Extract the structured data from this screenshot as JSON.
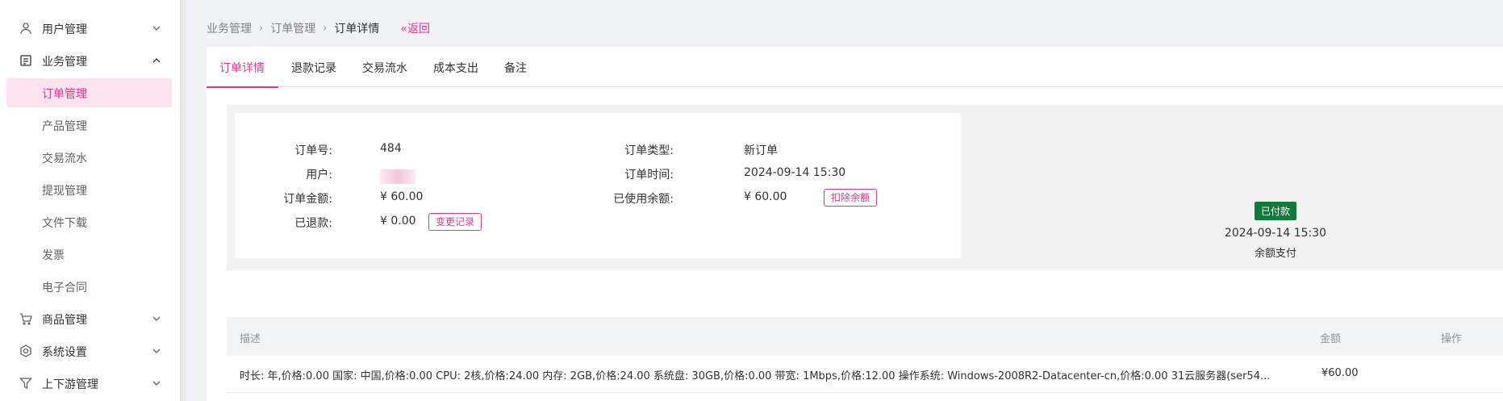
{
  "sidebar": {
    "groups": [
      {
        "label": "用户管理"
      },
      {
        "label": "业务管理"
      },
      {
        "label": "商品管理"
      },
      {
        "label": "系统设置"
      },
      {
        "label": "上下游管理"
      }
    ],
    "sub_items": [
      {
        "label": "订单管理"
      },
      {
        "label": "产品管理"
      },
      {
        "label": "交易流水"
      },
      {
        "label": "提现管理"
      },
      {
        "label": "文件下载"
      },
      {
        "label": "发票"
      },
      {
        "label": "电子合同"
      }
    ]
  },
  "breadcrumb": {
    "items": [
      "业务管理",
      "订单管理",
      "订单详情"
    ],
    "separator": "›",
    "back": "«返回"
  },
  "tabs": [
    "订单详情",
    "退款记录",
    "交易流水",
    "成本支出",
    "备注"
  ],
  "order": {
    "labels": {
      "order_no": "订单号:",
      "user": "用户:",
      "amount": "订单金额:",
      "refunded": "已退款:",
      "type": "订单类型:",
      "time": "订单时间:",
      "balance_used": "已使用余额:"
    },
    "values": {
      "order_no": "484",
      "amount": "¥ 60.00",
      "refunded": "¥ 0.00",
      "type": "新订单",
      "time": "2024-09-14 15:30",
      "balance_used": "¥ 60.00"
    },
    "buttons": {
      "change_log": "变更记录",
      "deduct_balance": "扣除余额"
    }
  },
  "status": {
    "badge": "已付款",
    "time": "2024-09-14 15:30",
    "method": "余额支付"
  },
  "table": {
    "headers": {
      "desc": "描述",
      "amount": "金额",
      "action": "操作"
    },
    "rows": [
      {
        "desc": "时长: 年,价格:0.00 国家: 中国,价格:0.00 CPU: 2核,价格:24.00 内存: 2GB,价格:24.00 系统盘: 30GB,价格:0.00 带宽: 1Mbps,价格:12.00 操作系统: Windows-2008R2-Datacenter-cn,价格:0.00 31云服务器(ser54...",
        "amount": "¥60.00"
      }
    ]
  },
  "colors": {
    "accent": "#e5348d",
    "badge": "#0f7a3a"
  }
}
